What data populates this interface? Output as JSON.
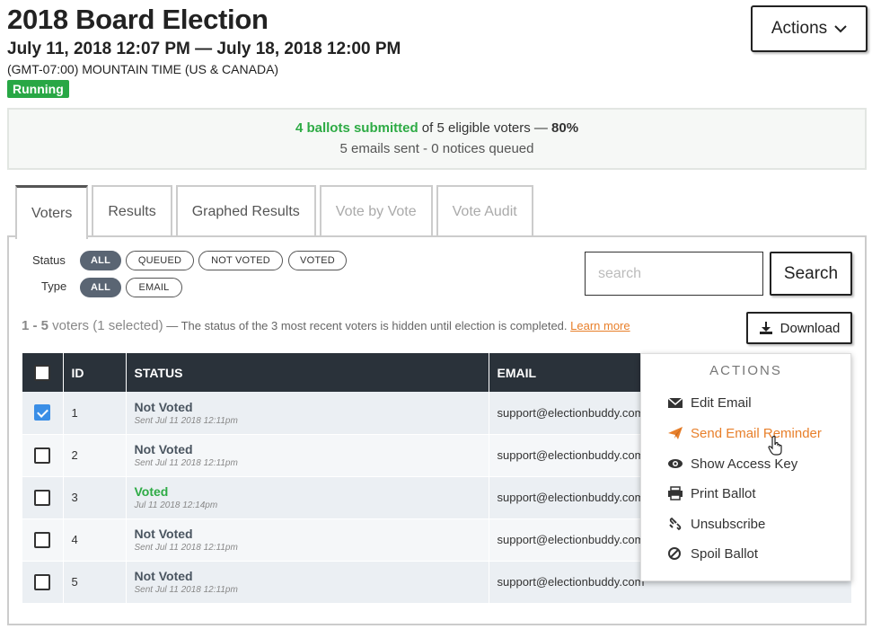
{
  "header": {
    "title": "2018 Board Election",
    "date_range": "July 11, 2018 12:07 PM — July 18, 2018 12:00 PM",
    "timezone": "(GMT-07:00) MOUNTAIN TIME (US & CANADA)",
    "status": "Running",
    "actions_label": "Actions"
  },
  "summary": {
    "ballots": "4 ballots submitted",
    "eligible": " of 5 eligible voters — ",
    "percent": "80%",
    "emails": "5 emails sent - 0 notices queued"
  },
  "tabs": [
    {
      "label": "Voters",
      "state": "active"
    },
    {
      "label": "Results",
      "state": "enabled"
    },
    {
      "label": "Graphed Results",
      "state": "enabled"
    },
    {
      "label": "Vote by Vote",
      "state": "disabled"
    },
    {
      "label": "Vote Audit",
      "state": "disabled"
    }
  ],
  "filters": {
    "status_label": "Status",
    "type_label": "Type",
    "status_options": [
      "ALL",
      "QUEUED",
      "NOT VOTED",
      "VOTED"
    ],
    "type_options": [
      "ALL",
      "EMAIL"
    ],
    "status_selected": "ALL",
    "type_selected": "ALL"
  },
  "search": {
    "placeholder": "search",
    "value": "",
    "button": "Search"
  },
  "list_info": {
    "range": "1 - 5",
    "voters": " voters (1 selected)",
    "note": " — The status of the 3 most recent voters is hidden until election is completed. ",
    "link": "Learn more",
    "download": "Download"
  },
  "table": {
    "columns": [
      "ID",
      "STATUS",
      "EMAIL"
    ],
    "rows": [
      {
        "id": "1",
        "status": "Not Voted",
        "sub": "Sent Jul 11 2018 12:11pm",
        "email": "support@electionbuddy.com",
        "checked": true
      },
      {
        "id": "2",
        "status": "Not Voted",
        "sub": "Sent Jul 11 2018 12:11pm",
        "email": "support@electionbuddy.com",
        "checked": false
      },
      {
        "id": "3",
        "status": "Voted",
        "sub": "Jul 11 2018 12:14pm",
        "email": "support@electionbuddy.com",
        "checked": false
      },
      {
        "id": "4",
        "status": "Not Voted",
        "sub": "Sent Jul 11 2018 12:11pm",
        "email": "support@electionbuddy.com",
        "checked": false
      },
      {
        "id": "5",
        "status": "Not Voted",
        "sub": "Sent Jul 11 2018 12:11pm",
        "email": "support@electionbuddy.com",
        "checked": false
      }
    ]
  },
  "actions_menu": {
    "header": "ACTIONS",
    "items": [
      {
        "label": "Edit Email",
        "icon": "envelope-icon"
      },
      {
        "label": "Send Email Reminder",
        "icon": "paper-plane-icon",
        "hovered": true
      },
      {
        "label": "Show Access Key",
        "icon": "eye-icon"
      },
      {
        "label": "Print Ballot",
        "icon": "printer-icon"
      },
      {
        "label": "Unsubscribe",
        "icon": "unlink-icon"
      },
      {
        "label": "Spoil Ballot",
        "icon": "ban-icon"
      }
    ]
  },
  "colors": {
    "accent_green": "#2eab45",
    "accent_orange": "#e87f2a",
    "table_header": "#2a323a"
  }
}
